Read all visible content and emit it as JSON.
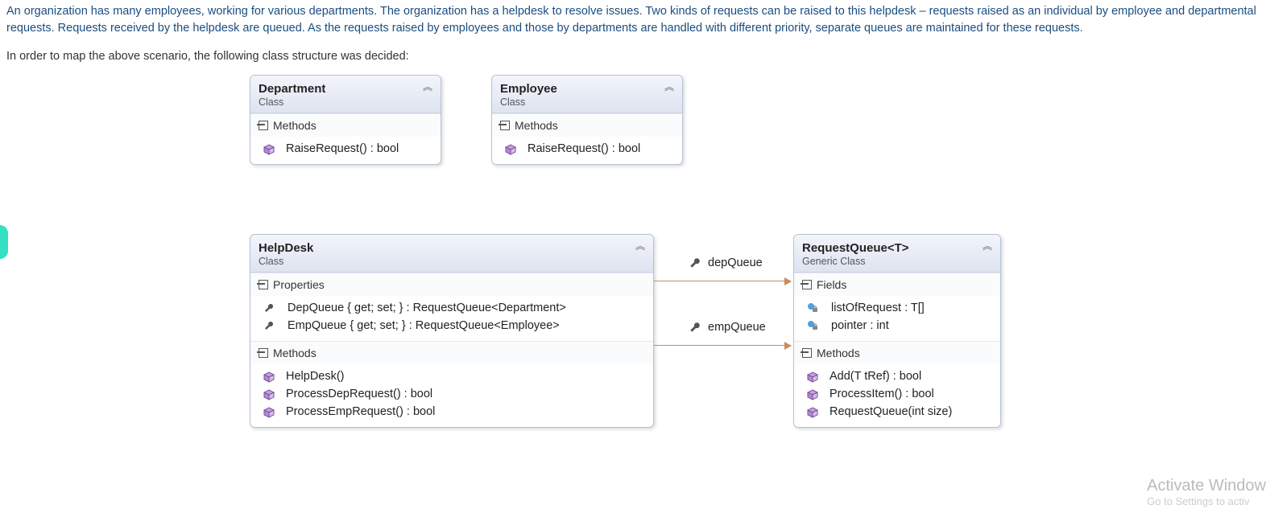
{
  "intro": {
    "p1": "An organization has many employees, working for various departments. The organization has a helpdesk to resolve issues. Two kinds of requests can be raised to this helpdesk – requests raised as an individual by employee and departmental requests. Requests received by the helpdesk are queued. As the requests raised by employees and those by departments are handled with different priority, separate queues are maintained for these requests.",
    "p2": "In order to map the above scenario, the following class structure was decided:"
  },
  "labels": {
    "class": "Class",
    "generic_class": "Generic Class",
    "methods": "Methods",
    "properties": "Properties",
    "fields": "Fields"
  },
  "classes": {
    "department": {
      "name": "Department",
      "methods": [
        "RaiseRequest() : bool"
      ]
    },
    "employee": {
      "name": "Employee",
      "methods": [
        "RaiseRequest() : bool"
      ]
    },
    "helpdesk": {
      "name": "HelpDesk",
      "properties": [
        "DepQueue { get; set; } : RequestQueue<Department>",
        "EmpQueue { get; set; } : RequestQueue<Employee>"
      ],
      "methods": [
        "HelpDesk()",
        "ProcessDepRequest() : bool",
        "ProcessEmpRequest() : bool"
      ]
    },
    "requestqueue": {
      "name": "RequestQueue<T>",
      "fields": [
        "listOfRequest : T[]",
        "pointer : int"
      ],
      "methods": [
        "Add(T tRef) : bool",
        "ProcessItem() : bool",
        "RequestQueue(int size)"
      ]
    }
  },
  "associations": {
    "dep": "depQueue",
    "emp": "empQueue"
  },
  "watermark": {
    "l1": "Activate Window",
    "l2": "Go to Settings to activ"
  }
}
